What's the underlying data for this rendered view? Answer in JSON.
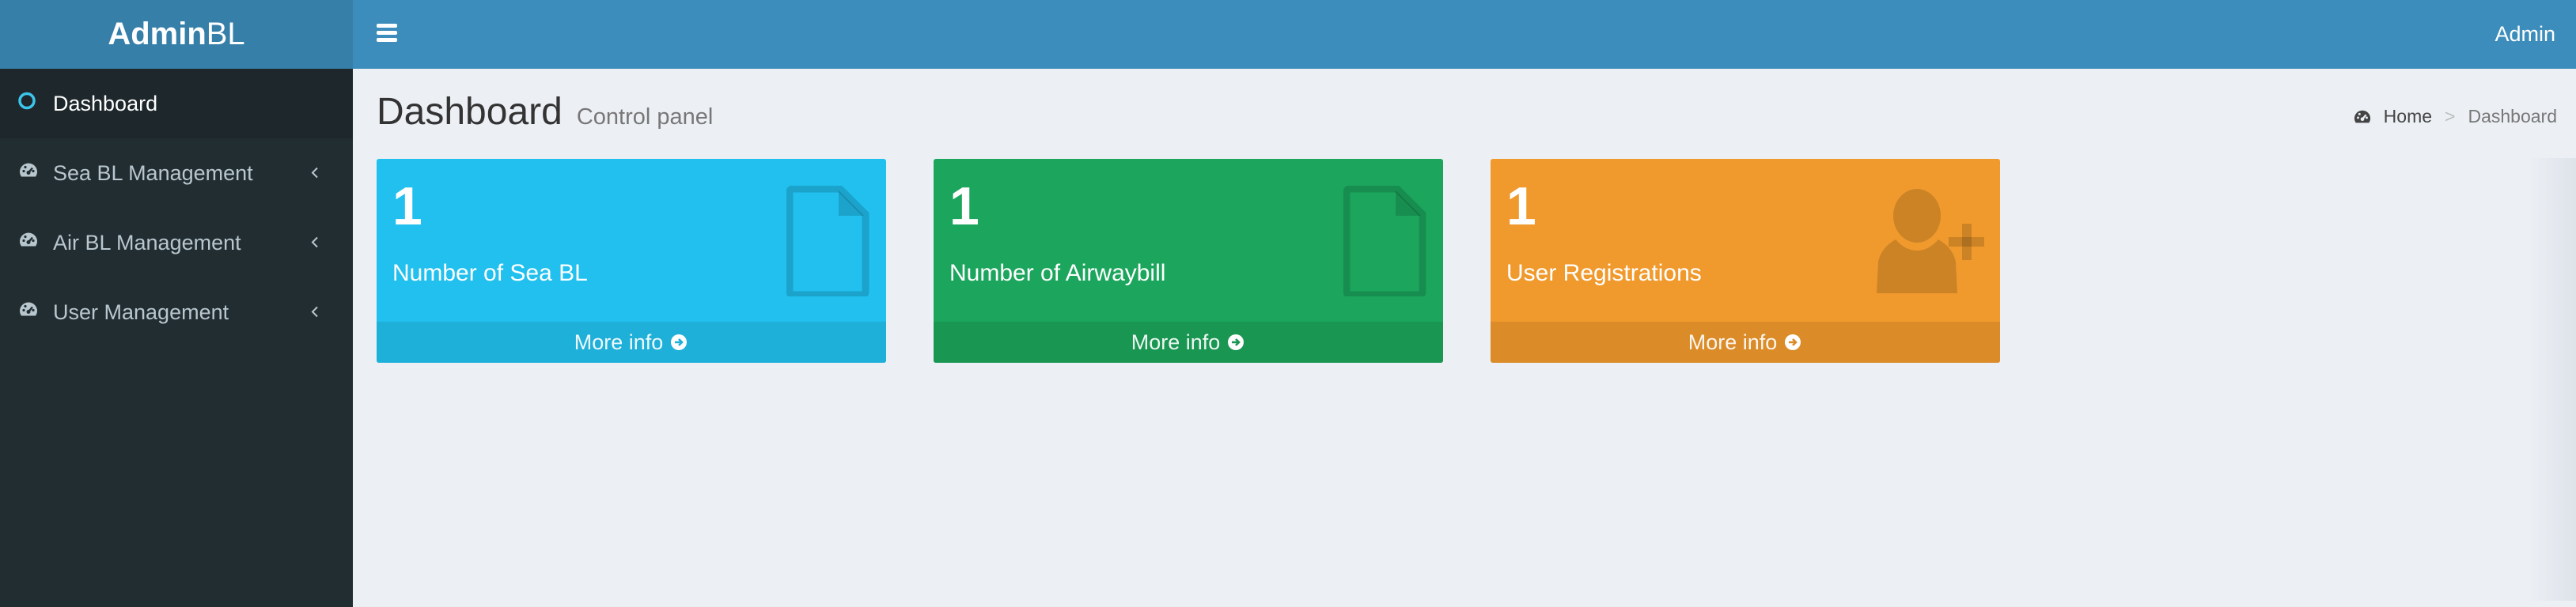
{
  "header": {
    "logo_bold": "Admin",
    "logo_light": "BL",
    "user_name": "Admin"
  },
  "sidebar": {
    "items": [
      {
        "label": "Dashboard",
        "icon": "circle-icon",
        "active": true
      },
      {
        "label": "Sea BL Management",
        "icon": "dashboard-icon"
      },
      {
        "label": "Air BL Management",
        "icon": "dashboard-icon"
      },
      {
        "label": "User Management",
        "icon": "dashboard-icon"
      }
    ]
  },
  "content": {
    "title": "Dashboard",
    "subtitle": "Control panel",
    "breadcrumb": {
      "home": "Home",
      "current": "Dashboard"
    }
  },
  "boxes": [
    {
      "value": "1",
      "caption": "Number of Sea BL",
      "more": "More info",
      "icon": "file-icon",
      "color": "#21c0ef"
    },
    {
      "value": "1",
      "caption": "Number of Airwaybill",
      "more": "More info",
      "icon": "file-icon",
      "color": "#1ca65d"
    },
    {
      "value": "1",
      "caption": "User Registrations",
      "more": "More info",
      "icon": "user-plus-icon",
      "color": "#f09a2d"
    }
  ],
  "colors": {
    "navbar": "#3c8dbc",
    "logo_bg": "#367fa9",
    "sidebar_bg": "#222d32",
    "content_bg": "#ecf0f5"
  }
}
